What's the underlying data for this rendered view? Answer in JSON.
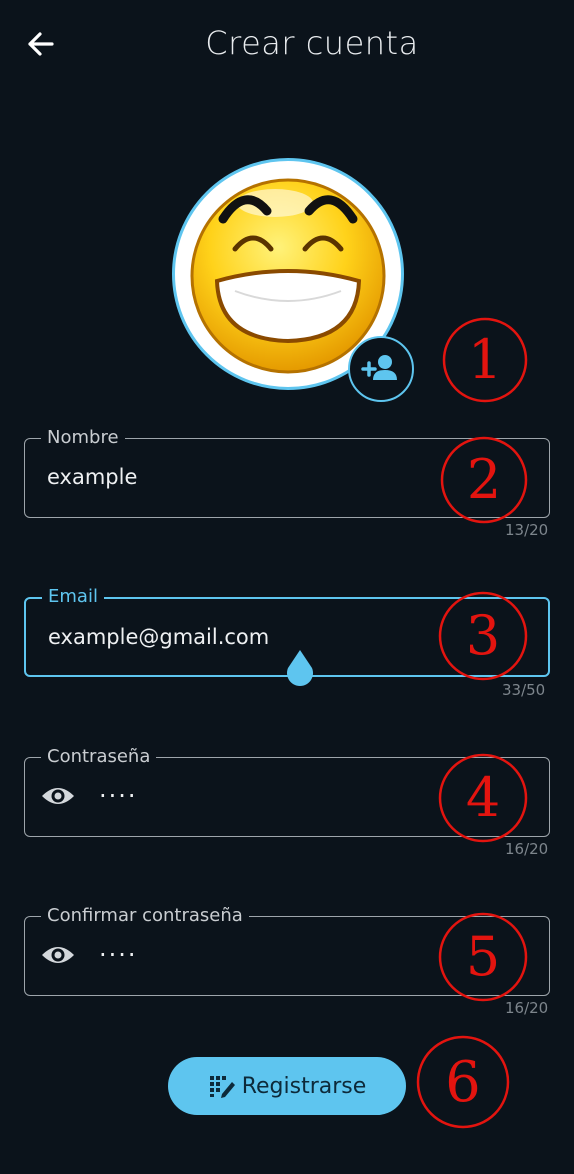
{
  "header": {
    "title": "Crear cuenta",
    "back_icon": "arrow-left-icon"
  },
  "avatar": {
    "image": "grinning-emoji",
    "add_icon": "person-add-icon"
  },
  "fields": {
    "name": {
      "label": "Nombre",
      "value": "example",
      "counter": "13/20"
    },
    "email": {
      "label": "Email",
      "value": "example@gmail.com",
      "counter": "33/50",
      "focused": true
    },
    "password": {
      "label": "Contraseña",
      "value": "····",
      "counter": "16/20",
      "icon": "eye-icon"
    },
    "confirm": {
      "label": "Confirmar contraseña",
      "value": "····",
      "counter": "16/20",
      "icon": "eye-icon"
    }
  },
  "register": {
    "label": "Registrarse",
    "icon": "register-icon"
  },
  "annotations": [
    "1",
    "2",
    "3",
    "4",
    "5",
    "6"
  ],
  "colors": {
    "background": "#0b131b",
    "accent": "#5ec5ef",
    "annotation": "#e3140f"
  }
}
